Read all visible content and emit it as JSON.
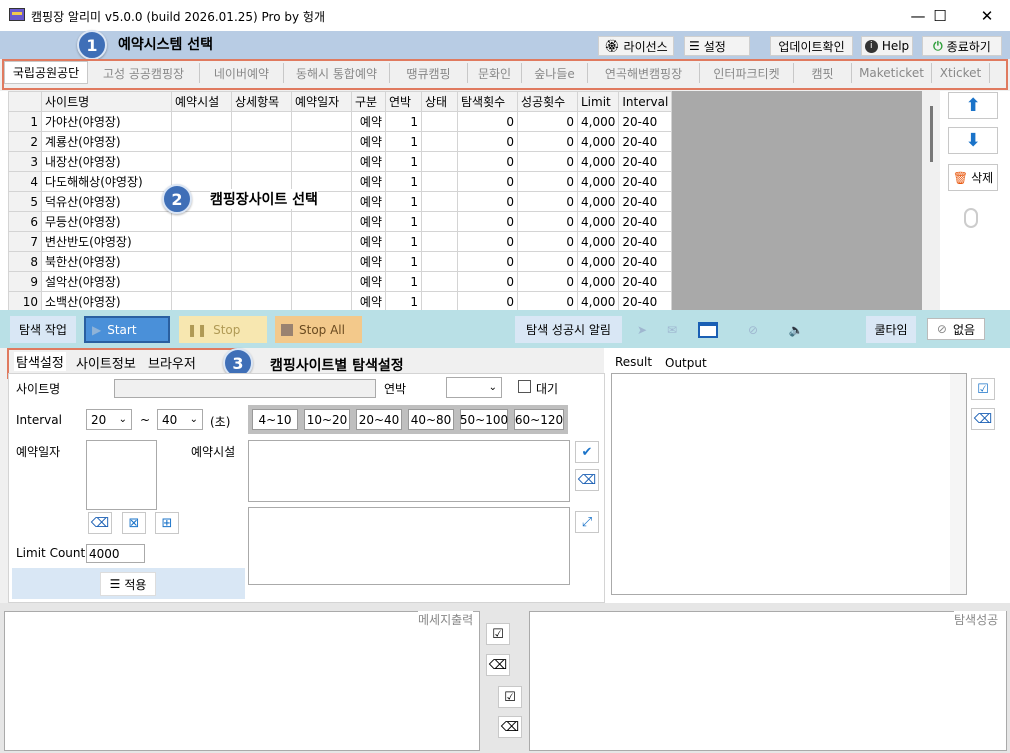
{
  "window": {
    "title": "캠핑장 알리미 v5.0.0 (build 2026.01.25) Pro by 헝개",
    "minimize": "—",
    "maximize": "☐",
    "close": "✕"
  },
  "annotations": {
    "badge1": "1",
    "badge1_label": "예약시스템 선택",
    "badge2": "2",
    "badge2_label": "캠핑장사이트 선택",
    "badge3": "3",
    "badge3_label": "캠핑사이트별 탐색설정"
  },
  "toolbar": {
    "license": "라이선스",
    "settings": "설정",
    "update": "업데이트확인",
    "help": "Help",
    "exit": "종료하기"
  },
  "tabs": [
    "국립공원공단",
    "고성 공공캠핑장",
    "네이버예약",
    "동해시 통합예약",
    "땡큐캠핑",
    "문화인",
    "숲나들e",
    "연곡해변캠핑장",
    "인터파크티켓",
    "캠핏",
    "Maketicket",
    "Xticket"
  ],
  "grid": {
    "headers": [
      "사이트명",
      "예약시설",
      "상세항목",
      "예약일자",
      "구분",
      "연박",
      "상태",
      "탐색횟수",
      "성공횟수",
      "Limit",
      "Interval"
    ],
    "rows": [
      {
        "n": "1",
        "name": "가야산(야영장)",
        "kind": "예약",
        "nights": "1",
        "search": "0",
        "success": "0",
        "limit": "4,000",
        "interval": "20-40"
      },
      {
        "n": "2",
        "name": "계룡산(야영장)",
        "kind": "예약",
        "nights": "1",
        "search": "0",
        "success": "0",
        "limit": "4,000",
        "interval": "20-40"
      },
      {
        "n": "3",
        "name": "내장산(야영장)",
        "kind": "예약",
        "nights": "1",
        "search": "0",
        "success": "0",
        "limit": "4,000",
        "interval": "20-40"
      },
      {
        "n": "4",
        "name": "다도해해상(야영장)",
        "kind": "예약",
        "nights": "1",
        "search": "0",
        "success": "0",
        "limit": "4,000",
        "interval": "20-40"
      },
      {
        "n": "5",
        "name": "덕유산(야영장)",
        "kind": "예약",
        "nights": "1",
        "search": "0",
        "success": "0",
        "limit": "4,000",
        "interval": "20-40"
      },
      {
        "n": "6",
        "name": "무등산(야영장)",
        "kind": "예약",
        "nights": "1",
        "search": "0",
        "success": "0",
        "limit": "4,000",
        "interval": "20-40"
      },
      {
        "n": "7",
        "name": "변산반도(야영장)",
        "kind": "예약",
        "nights": "1",
        "search": "0",
        "success": "0",
        "limit": "4,000",
        "interval": "20-40"
      },
      {
        "n": "8",
        "name": "북한산(야영장)",
        "kind": "예약",
        "nights": "1",
        "search": "0",
        "success": "0",
        "limit": "4,000",
        "interval": "20-40"
      },
      {
        "n": "9",
        "name": "설악산(야영장)",
        "kind": "예약",
        "nights": "1",
        "search": "0",
        "success": "0",
        "limit": "4,000",
        "interval": "20-40"
      },
      {
        "n": "10",
        "name": "소백산(야영장)",
        "kind": "예약",
        "nights": "1",
        "search": "0",
        "success": "0",
        "limit": "4,000",
        "interval": "20-40"
      }
    ]
  },
  "side": {
    "up": "⬆",
    "down": "⬇",
    "delete": "삭제"
  },
  "action": {
    "label": "탐색 작업",
    "start": "Start",
    "stop": "Stop",
    "stop_all": "Stop All",
    "notify": "탐색 성공시 알림",
    "cooltime": "쿨타임",
    "none": "없음"
  },
  "settings": {
    "tabs": [
      "탐색설정",
      "사이트정보",
      "브라우저"
    ],
    "site_name": "사이트명",
    "nights": "연박",
    "wait": "대기",
    "interval": "Interval",
    "interval_from": "20",
    "interval_to": "40",
    "tilde": "~",
    "seconds": "(초)",
    "ranges": [
      "4~10",
      "10~20",
      "20~40",
      "40~80",
      "50~100",
      "60~120"
    ],
    "dates": "예약일자",
    "facility": "예약시설",
    "limit_count": "Limit Count",
    "limit_value": "4000",
    "apply": "적용"
  },
  "result": {
    "tabs": [
      "Result",
      "Output"
    ]
  },
  "bottom": {
    "message": "메세지출력",
    "success": "탐색성공"
  },
  "colors": {
    "band": "#b8cce4",
    "action": "#b9e0e6",
    "start": "#4a90d9",
    "stop": "#f7e7b0",
    "stopall": "#f3c98b",
    "badge": "#3f6fb7",
    "outline": "#e07a5f"
  }
}
